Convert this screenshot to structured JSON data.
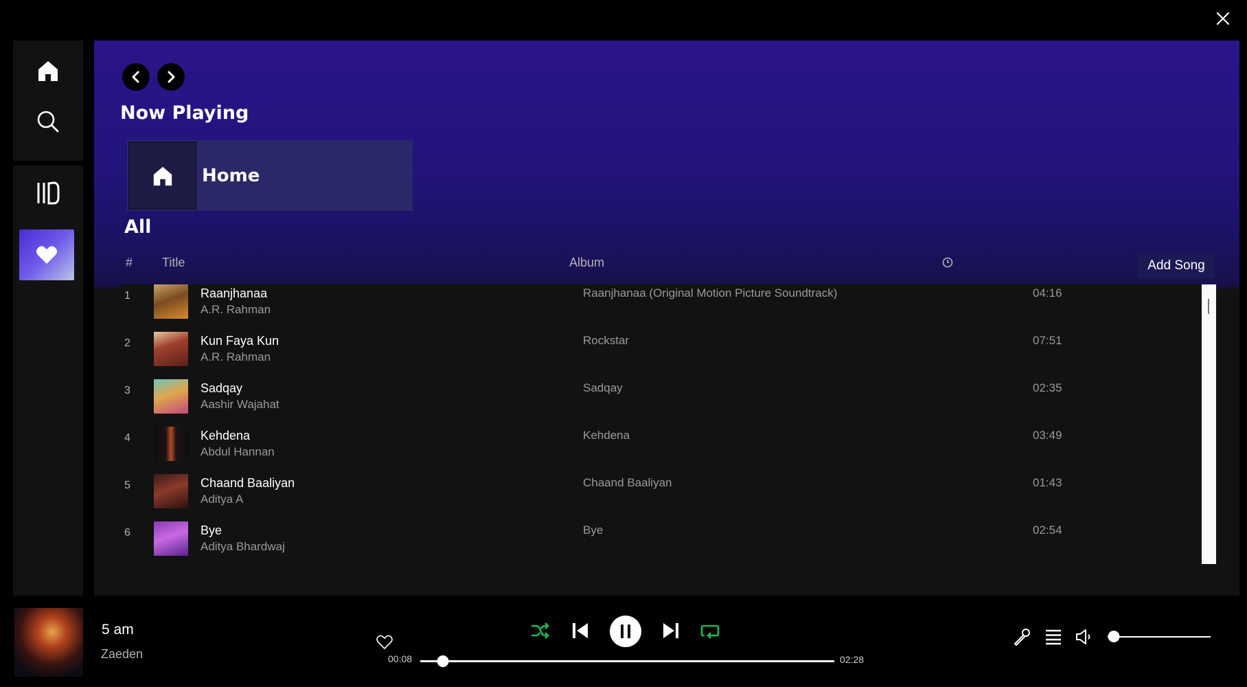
{
  "window": {
    "close_icon": "close-icon"
  },
  "sidebar": {
    "items": [
      {
        "name": "home",
        "icon": "home-icon"
      },
      {
        "name": "search",
        "icon": "search-icon"
      },
      {
        "name": "library",
        "icon": "library-icon"
      },
      {
        "name": "liked-songs",
        "icon": "heart-icon"
      }
    ]
  },
  "header": {
    "title": "Now Playing",
    "back_icon": "chevron-left-icon",
    "forward_icon": "chevron-right-icon"
  },
  "home_card": {
    "label": "Home",
    "icon": "home-icon"
  },
  "section": {
    "title": "All"
  },
  "table": {
    "headers": {
      "num": "#",
      "title": "Title",
      "album": "Album",
      "duration_icon": "clock-icon"
    },
    "add_song_label": "Add Song",
    "rows": [
      {
        "num": "1",
        "title": "Raanjhanaa",
        "artist": "A.R. Rahman",
        "album": "Raanjhanaa (Original Motion Picture Soundtrack)",
        "duration": "04:16"
      },
      {
        "num": "2",
        "title": "Kun Faya Kun",
        "artist": "A.R. Rahman",
        "album": "Rockstar",
        "duration": "07:51"
      },
      {
        "num": "3",
        "title": "Sadqay",
        "artist": "Aashir Wajahat",
        "album": "Sadqay",
        "duration": "02:35"
      },
      {
        "num": "4",
        "title": "Kehdena",
        "artist": "Abdul Hannan",
        "album": "Kehdena",
        "duration": "03:49"
      },
      {
        "num": "5",
        "title": "Chaand Baaliyan",
        "artist": "Aditya A",
        "album": "Chaand Baaliyan",
        "duration": "01:43"
      },
      {
        "num": "6",
        "title": "Bye",
        "artist": "Aditya Bhardwaj",
        "album": "Bye",
        "duration": "02:54"
      }
    ]
  },
  "player": {
    "track_title": "5 am",
    "track_artist": "Zaeden",
    "elapsed": "00:08",
    "total": "02:28",
    "progress_fraction": 0.054,
    "volume_fraction": 0.06,
    "accent_color": "#1db954",
    "icons": [
      "heart-outline-icon",
      "shuffle-icon",
      "previous-icon",
      "pause-icon",
      "next-icon",
      "repeat-icon",
      "lyrics-mic-icon",
      "queue-icon",
      "volume-icon"
    ]
  }
}
